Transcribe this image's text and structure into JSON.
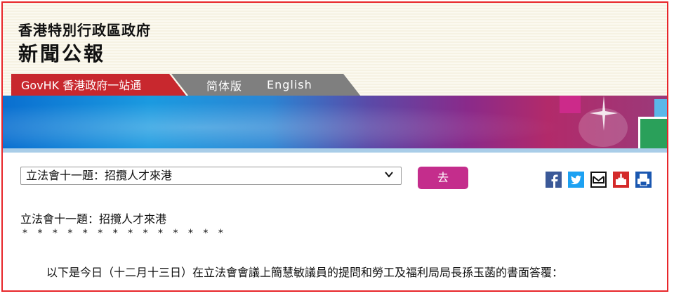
{
  "header": {
    "org_name": "香港特別行政區政府",
    "title": "新聞公報"
  },
  "nav": {
    "govhk": "GovHK 香港政府一站通",
    "simplified": "简体版",
    "english": "English"
  },
  "toolbar": {
    "select_value": "立法會十一題：招攬人才來港",
    "go_label": "去",
    "share_icons": [
      "facebook-icon",
      "twitter-icon",
      "email-icon",
      "download-icon",
      "print-icon"
    ]
  },
  "article": {
    "title": "立法會十一題：招攬人才來港",
    "separator": "* * * * * * * * * * * * * *",
    "intro": "以下是今日（十二月十三日）在立法會會議上簡慧敏議員的提問和勞工及福利局局長孫玉菡的書面答覆："
  },
  "colors": {
    "brand_red": "#c8282e",
    "button_magenta": "#c42d8c",
    "frame_red": "#e8262a"
  }
}
